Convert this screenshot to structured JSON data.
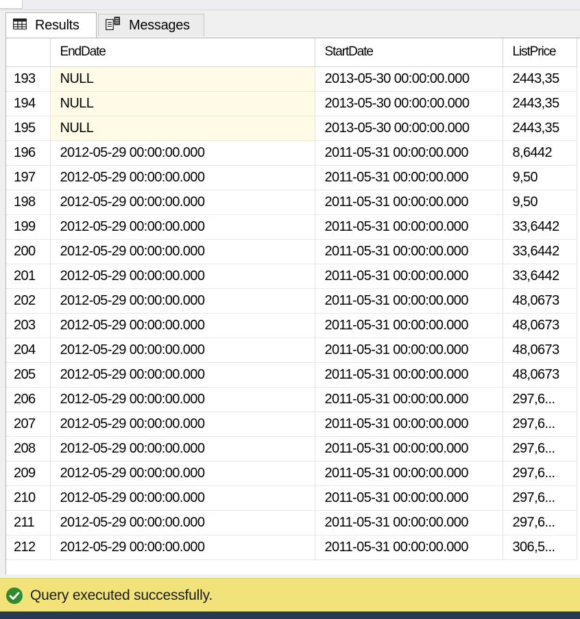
{
  "tabs": {
    "results_label": "Results",
    "messages_label": "Messages",
    "results_icon": "grid-icon",
    "messages_icon": "messages-icon"
  },
  "grid": {
    "columns": [
      "",
      "EndDate",
      "StartDate",
      "ListPrice"
    ],
    "rows": [
      {
        "num": "193",
        "end": "NULL",
        "start": "2013-05-30 00:00:00.000",
        "price": "2443,35"
      },
      {
        "num": "194",
        "end": "NULL",
        "start": "2013-05-30 00:00:00.000",
        "price": "2443,35"
      },
      {
        "num": "195",
        "end": "NULL",
        "start": "2013-05-30 00:00:00.000",
        "price": "2443,35"
      },
      {
        "num": "196",
        "end": "2012-05-29 00:00:00.000",
        "start": "2011-05-31 00:00:00.000",
        "price": "8,6442"
      },
      {
        "num": "197",
        "end": "2012-05-29 00:00:00.000",
        "start": "2011-05-31 00:00:00.000",
        "price": "9,50"
      },
      {
        "num": "198",
        "end": "2012-05-29 00:00:00.000",
        "start": "2011-05-31 00:00:00.000",
        "price": "9,50"
      },
      {
        "num": "199",
        "end": "2012-05-29 00:00:00.000",
        "start": "2011-05-31 00:00:00.000",
        "price": "33,6442"
      },
      {
        "num": "200",
        "end": "2012-05-29 00:00:00.000",
        "start": "2011-05-31 00:00:00.000",
        "price": "33,6442"
      },
      {
        "num": "201",
        "end": "2012-05-29 00:00:00.000",
        "start": "2011-05-31 00:00:00.000",
        "price": "33,6442"
      },
      {
        "num": "202",
        "end": "2012-05-29 00:00:00.000",
        "start": "2011-05-31 00:00:00.000",
        "price": "48,0673"
      },
      {
        "num": "203",
        "end": "2012-05-29 00:00:00.000",
        "start": "2011-05-31 00:00:00.000",
        "price": "48,0673"
      },
      {
        "num": "204",
        "end": "2012-05-29 00:00:00.000",
        "start": "2011-05-31 00:00:00.000",
        "price": "48,0673"
      },
      {
        "num": "205",
        "end": "2012-05-29 00:00:00.000",
        "start": "2011-05-31 00:00:00.000",
        "price": "48,0673"
      },
      {
        "num": "206",
        "end": "2012-05-29 00:00:00.000",
        "start": "2011-05-31 00:00:00.000",
        "price": "297,6..."
      },
      {
        "num": "207",
        "end": "2012-05-29 00:00:00.000",
        "start": "2011-05-31 00:00:00.000",
        "price": "297,6..."
      },
      {
        "num": "208",
        "end": "2012-05-29 00:00:00.000",
        "start": "2011-05-31 00:00:00.000",
        "price": "297,6..."
      },
      {
        "num": "209",
        "end": "2012-05-29 00:00:00.000",
        "start": "2011-05-31 00:00:00.000",
        "price": "297,6..."
      },
      {
        "num": "210",
        "end": "2012-05-29 00:00:00.000",
        "start": "2011-05-31 00:00:00.000",
        "price": "297,6..."
      },
      {
        "num": "211",
        "end": "2012-05-29 00:00:00.000",
        "start": "2011-05-31 00:00:00.000",
        "price": "297,6..."
      },
      {
        "num": "212",
        "end": "2012-05-29 00:00:00.000",
        "start": "2011-05-31 00:00:00.000",
        "price": "306,5..."
      }
    ],
    "null_cell_color": "#fffbe6"
  },
  "status": {
    "icon": "success-check-icon",
    "text": "Query executed successfully.",
    "color": "#f2e27a",
    "icon_color": "#2e8b2e"
  }
}
